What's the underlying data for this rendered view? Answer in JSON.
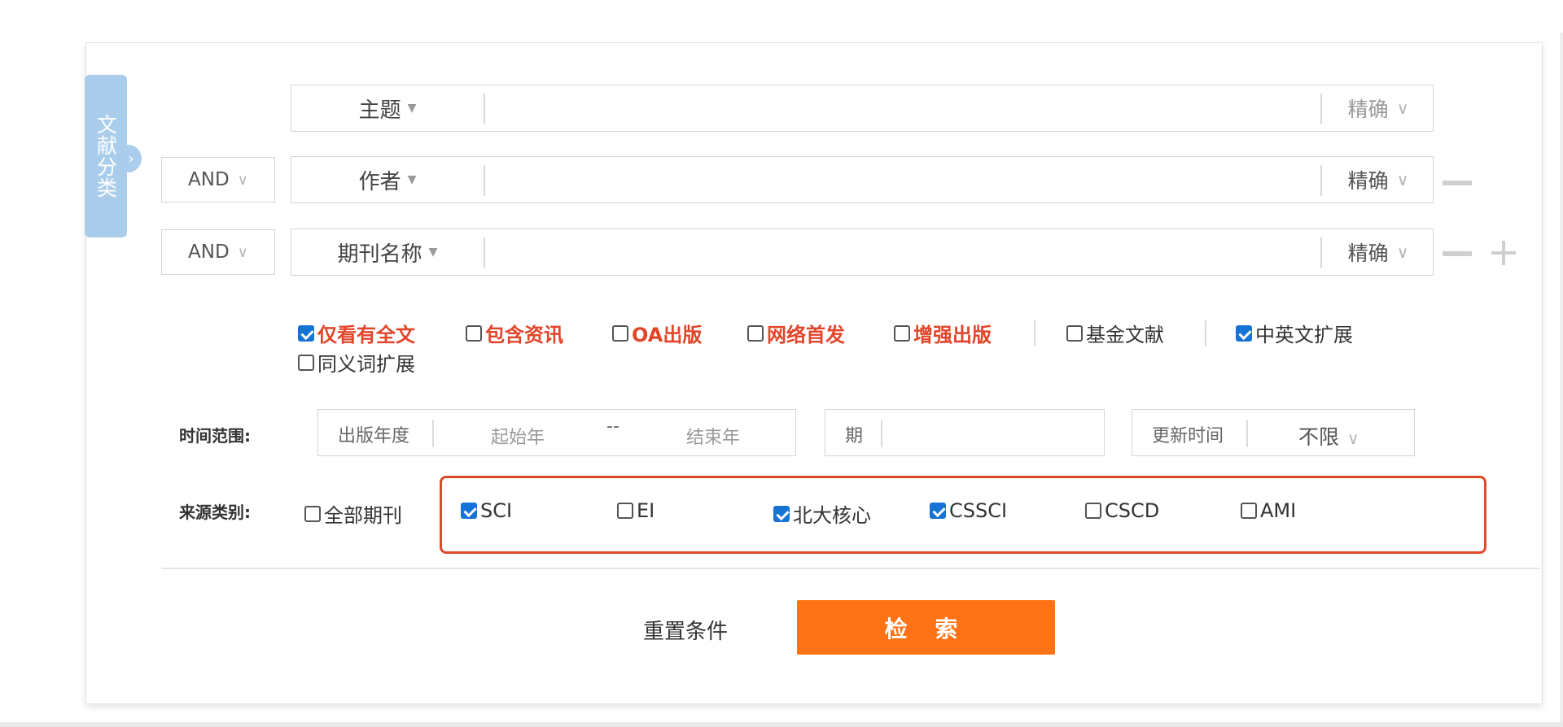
{
  "side_tab": {
    "label": "文献分类"
  },
  "rows": [
    {
      "logic": "",
      "field": "主题",
      "match": "精确"
    },
    {
      "logic": "AND",
      "field": "作者",
      "match": "精确"
    },
    {
      "logic": "AND",
      "field": "期刊名称",
      "match": "精确"
    }
  ],
  "options": {
    "full_text": "仅看有全文",
    "news": "包含资讯",
    "oa": "OA出版",
    "online_first": "网络首发",
    "enhanced": "增强出版",
    "fund": "基金文献",
    "cn_en": "中英文扩展",
    "synonym": "同义词扩展"
  },
  "time": {
    "label": "时间范围:",
    "year_type": "出版年度",
    "start_ph": "起始年",
    "dash": "--",
    "end_ph": "结束年",
    "issue": "期",
    "update_label": "更新时间",
    "update_value": "不限"
  },
  "source": {
    "label": "来源类别:",
    "all": "全部期刊",
    "items": [
      "SCI",
      "EI",
      "北大核心",
      "CSSCI",
      "CSCD",
      "AMI"
    ]
  },
  "actions": {
    "reset": "重置条件",
    "search": "检 索"
  }
}
